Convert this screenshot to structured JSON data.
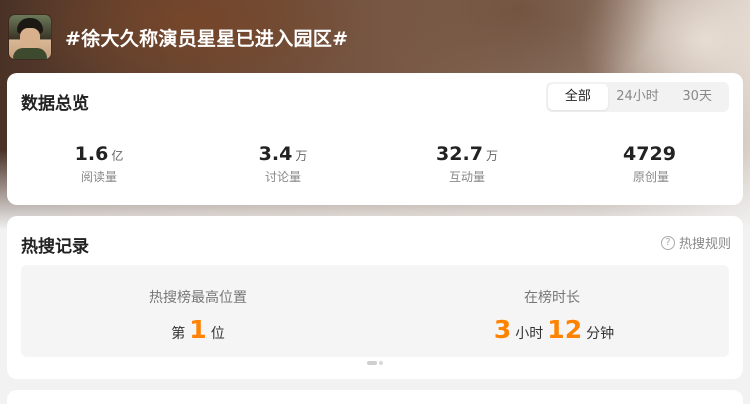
{
  "header": {
    "topic_title": "#徐大久称演员星星已进入园区#",
    "avatar": "topic-avatar"
  },
  "overview": {
    "title": "数据总览",
    "tabs": [
      {
        "label": "全部",
        "active": true
      },
      {
        "label": "24小时",
        "active": false
      },
      {
        "label": "30天",
        "active": false
      }
    ],
    "stats": [
      {
        "value": "1.6",
        "unit": "亿",
        "label": "阅读量"
      },
      {
        "value": "3.4",
        "unit": "万",
        "label": "讨论量"
      },
      {
        "value": "32.7",
        "unit": "万",
        "label": "互动量"
      },
      {
        "value": "4729",
        "unit": "",
        "label": "原创量"
      }
    ]
  },
  "hot_search": {
    "title": "热搜记录",
    "rules_label": "热搜规则",
    "rules_icon": "question-circle-icon",
    "peak": {
      "label": "热搜榜最高位置",
      "prefix": "第",
      "value": "1",
      "suffix": "位"
    },
    "duration": {
      "label": "在榜时长",
      "hours": "3",
      "hours_unit": "小时",
      "minutes": "12",
      "minutes_unit": "分钟"
    },
    "accent_color": "#ff8200"
  }
}
